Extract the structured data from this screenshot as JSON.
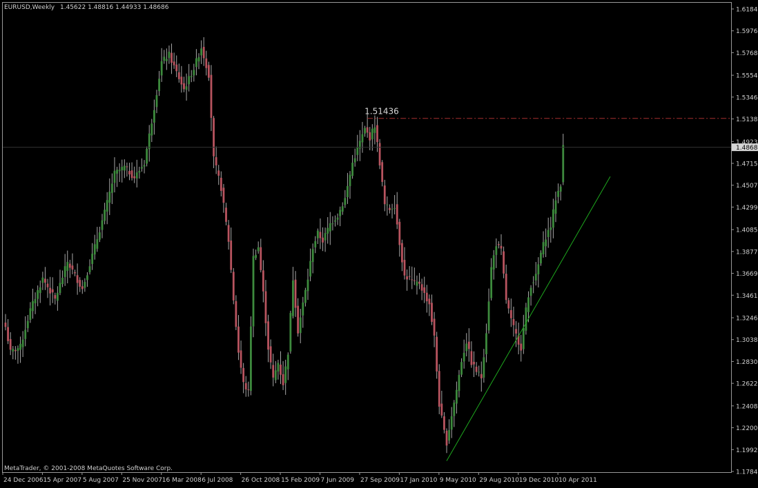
{
  "window": {
    "symbol_label": "EURUSD,Weekly",
    "ohlc": "1.45622 1.48816 1.44933 1.48686",
    "copyright": "MetaTrader, © 2001-2008 MetaQuotes Software Corp.",
    "current_price_label": "1.48686",
    "resistance_label": "1.51436"
  },
  "colors": {
    "background": "#000000",
    "bull": "#3d8a3d",
    "bear": "#b8545f",
    "wick": "#a8a8a8",
    "axis_text": "#d0d0d0",
    "trendline": "#1ea81e",
    "resistance": "#a82f2f",
    "price_marker_bg": "#d6d6d6"
  },
  "chart_data": {
    "type": "candlestick",
    "y_ticks": [
      "1.61845",
      "1.59765",
      "1.57685",
      "1.55540",
      "1.53460",
      "1.51380",
      "1.49235",
      "1.47155",
      "1.45075",
      "1.42995",
      "1.40850",
      "1.38770",
      "1.36690",
      "1.34610",
      "1.32465",
      "1.30385",
      "1.28305",
      "1.26225",
      "1.24080",
      "1.22000",
      "1.19920",
      "1.17840"
    ],
    "ylim": [
      1.1784,
      1.61845
    ],
    "x_ticks": [
      "24 Dec 2006",
      "15 Apr 2007",
      "5 Aug 2007",
      "25 Nov 2007",
      "16 Mar 2008",
      "6 Jul 2008",
      "26 Oct 2008",
      "15 Feb 2009",
      "7 Jun 2009",
      "27 Sep 2009",
      "17 Jan 2010",
      "9 May 2010",
      "29 Aug 2010",
      "19 Dec 2010",
      "10 Apr 2011"
    ],
    "x_tick_index": [
      0,
      16,
      32,
      48,
      64,
      80,
      96,
      112,
      128,
      144,
      160,
      176,
      192,
      208,
      224
    ],
    "anchors": [
      [
        0,
        1.316
      ],
      [
        2,
        1.292
      ],
      [
        6,
        1.297
      ],
      [
        10,
        1.332
      ],
      [
        15,
        1.362
      ],
      [
        20,
        1.342
      ],
      [
        25,
        1.378
      ],
      [
        31,
        1.352
      ],
      [
        36,
        1.392
      ],
      [
        40,
        1.425
      ],
      [
        44,
        1.462
      ],
      [
        48,
        1.468
      ],
      [
        52,
        1.458
      ],
      [
        56,
        1.472
      ],
      [
        60,
        1.525
      ],
      [
        63,
        1.568
      ],
      [
        66,
        1.575
      ],
      [
        69,
        1.558
      ],
      [
        72,
        1.542
      ],
      [
        76,
        1.562
      ],
      [
        79,
        1.582
      ],
      [
        82,
        1.556
      ],
      [
        84,
        1.476
      ],
      [
        87,
        1.448
      ],
      [
        90,
        1.398
      ],
      [
        92,
        1.342
      ],
      [
        94,
        1.292
      ],
      [
        96,
        1.262
      ],
      [
        98,
        1.254
      ],
      [
        100,
        1.382
      ],
      [
        102,
        1.392
      ],
      [
        104,
        1.348
      ],
      [
        106,
        1.296
      ],
      [
        108,
        1.266
      ],
      [
        110,
        1.282
      ],
      [
        112,
        1.262
      ],
      [
        114,
        1.292
      ],
      [
        116,
        1.362
      ],
      [
        118,
        1.312
      ],
      [
        120,
        1.338
      ],
      [
        122,
        1.362
      ],
      [
        124,
        1.392
      ],
      [
        126,
        1.405
      ],
      [
        128,
        1.398
      ],
      [
        131,
        1.414
      ],
      [
        134,
        1.422
      ],
      [
        137,
        1.438
      ],
      [
        140,
        1.472
      ],
      [
        143,
        1.492
      ],
      [
        145,
        1.504
      ],
      [
        147,
        1.496
      ],
      [
        149,
        1.508
      ],
      [
        151,
        1.472
      ],
      [
        153,
        1.432
      ],
      [
        155,
        1.428
      ],
      [
        157,
        1.432
      ],
      [
        159,
        1.396
      ],
      [
        161,
        1.364
      ],
      [
        163,
        1.362
      ],
      [
        165,
        1.357
      ],
      [
        167,
        1.358
      ],
      [
        169,
        1.347
      ],
      [
        171,
        1.338
      ],
      [
        173,
        1.306
      ],
      [
        175,
        1.242
      ],
      [
        177,
        1.216
      ],
      [
        178,
        1.206
      ],
      [
        180,
        1.232
      ],
      [
        182,
        1.256
      ],
      [
        184,
        1.284
      ],
      [
        186,
        1.302
      ],
      [
        188,
        1.282
      ],
      [
        190,
        1.274
      ],
      [
        192,
        1.268
      ],
      [
        194,
        1.312
      ],
      [
        196,
        1.372
      ],
      [
        198,
        1.395
      ],
      [
        200,
        1.388
      ],
      [
        202,
        1.342
      ],
      [
        204,
        1.322
      ],
      [
        206,
        1.308
      ],
      [
        208,
        1.296
      ],
      [
        210,
        1.332
      ],
      [
        212,
        1.356
      ],
      [
        214,
        1.364
      ],
      [
        216,
        1.386
      ],
      [
        218,
        1.402
      ],
      [
        220,
        1.412
      ],
      [
        222,
        1.438
      ],
      [
        224,
        1.452
      ],
      [
        225,
        1.487
      ]
    ],
    "trendline": [
      [
        178,
        1.1885
      ],
      [
        244,
        1.459
      ]
    ],
    "resistance": {
      "start": 146,
      "value": 1.51436
    },
    "current_price": 1.48686,
    "grid": false
  }
}
